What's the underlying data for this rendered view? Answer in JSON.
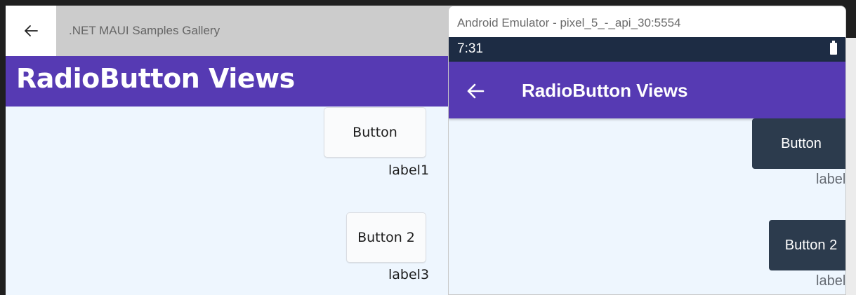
{
  "windows_app": {
    "title": ".NET MAUI Samples Gallery",
    "page_title": "RadioButton Views",
    "button1": "Button",
    "label1": "label1",
    "button2": "Button 2",
    "label3": "label3"
  },
  "emulator": {
    "window_title": "Android Emulator - pixel_5_-_api_30:5554",
    "time": "7:31",
    "page_title": "RadioButton Views",
    "button1": "Button",
    "label1": "label",
    "button2": "Button 2",
    "label3": "label"
  },
  "colors": {
    "header": "#563ab3",
    "status_bar": "#1d2c44",
    "android_button": "#2c3b4d",
    "page_background": "#eef6fe"
  },
  "icons": [
    "back-arrow-icon",
    "battery-icon"
  ]
}
